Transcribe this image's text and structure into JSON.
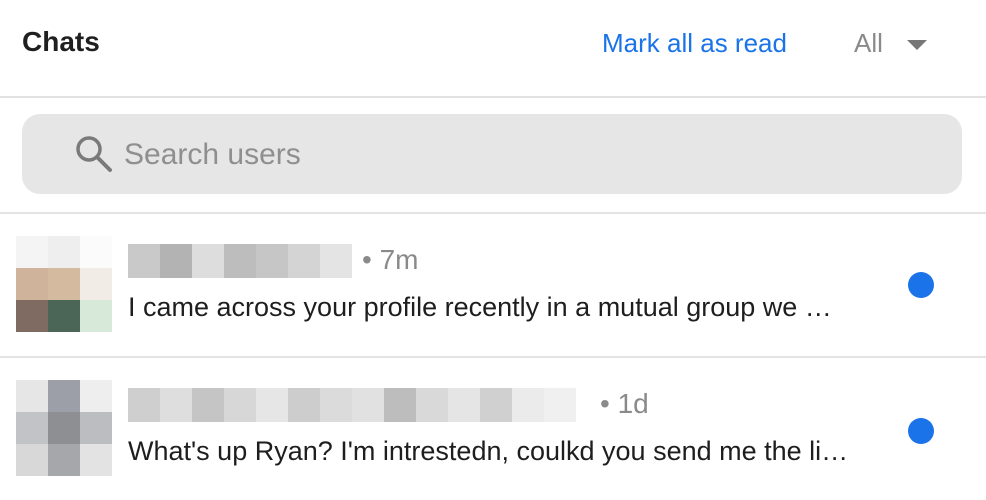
{
  "header": {
    "title": "Chats",
    "mark_all_read": "Mark all as read",
    "filter": {
      "selected": "All"
    }
  },
  "search": {
    "placeholder": "Search users"
  },
  "chats": [
    {
      "time": "• 7m",
      "preview": "I came across your profile recently in a mutual group we …",
      "unread": true
    },
    {
      "time": "• 1d",
      "preview": "What's up Ryan? I'm intrestedn, coulkd you send me the li…",
      "unread": true
    }
  ],
  "colors": {
    "accent": "#1a73e8",
    "search_bg": "#e6e6e6",
    "muted_text": "#8a8a8a"
  },
  "icons": [
    "search-icon",
    "chevron-down-icon"
  ]
}
